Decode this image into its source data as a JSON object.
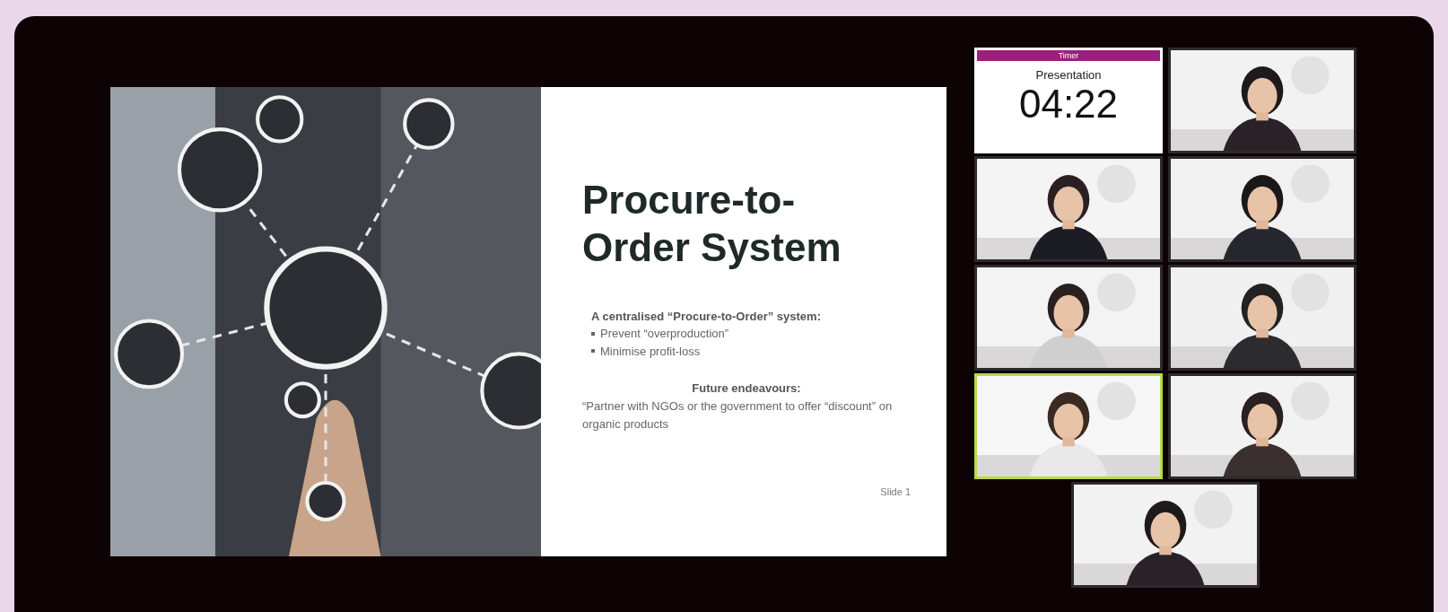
{
  "slide": {
    "title": "Procure-to-Order System",
    "intro": "A centralised “Procure-to-Order” system:",
    "bullets": [
      "Prevent “overproduction”",
      "Minimise profit-loss"
    ],
    "subheading": "Future endeavours:",
    "note": "“Partner with NGOs or the government to offer “discount” on organic products",
    "footer": "Slide 1"
  },
  "timer": {
    "header": "Timer",
    "label": "Presentation",
    "time": "04:22"
  },
  "tiles": [
    {
      "kind": "picture",
      "selected": false
    },
    {
      "kind": "picture",
      "selected": false
    },
    {
      "kind": "picture",
      "selected": false
    },
    {
      "kind": "picture",
      "selected": false
    },
    {
      "kind": "picture",
      "selected": false
    },
    {
      "kind": "picture",
      "selected": true
    },
    {
      "kind": "picture",
      "selected": false
    }
  ],
  "bottom_tile": {
    "kind": "picture",
    "selected": false
  }
}
